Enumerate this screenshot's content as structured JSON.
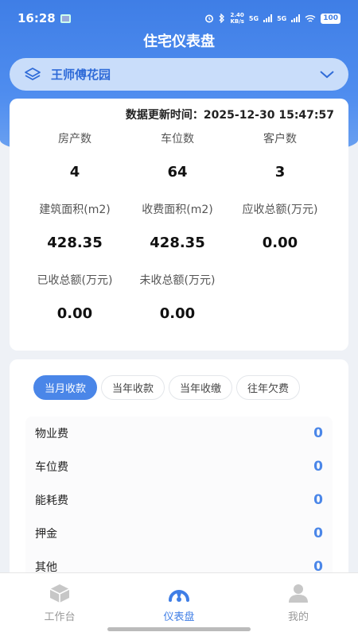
{
  "status": {
    "time": "16:28",
    "speed_top": "2.40",
    "speed_unit": "KB/s",
    "net1": "5G",
    "net2": "5G",
    "battery": "100"
  },
  "header": {
    "title": "住宅仪表盘"
  },
  "selector": {
    "label": "王师傅花园",
    "icon": "stack-layers-icon",
    "chevron": "chevron-down-icon"
  },
  "stats": {
    "update_label": "数据更新时间：",
    "update_time": "2025-12-30 15:47:57",
    "items": [
      {
        "label": "房产数",
        "value": "4"
      },
      {
        "label": "车位数",
        "value": "64"
      },
      {
        "label": "客户数",
        "value": "3"
      },
      {
        "label": "建筑面积(m2)",
        "value": "428.35"
      },
      {
        "label": "收费面积(m2)",
        "value": "428.35"
      },
      {
        "label": "应收总额(万元)",
        "value": "0.00"
      },
      {
        "label": "已收总额(万元)",
        "value": "0.00"
      },
      {
        "label": "未收总额(万元)",
        "value": "0.00"
      }
    ]
  },
  "fees": {
    "tabs": [
      "当月收款",
      "当年收款",
      "当年收缴",
      "往年欠费"
    ],
    "active_tab": 0,
    "rows": [
      {
        "label": "物业费",
        "value": "0"
      },
      {
        "label": "车位费",
        "value": "0"
      },
      {
        "label": "能耗费",
        "value": "0"
      },
      {
        "label": "押金",
        "value": "0"
      },
      {
        "label": "其他",
        "value": "0"
      }
    ]
  },
  "tabbar": {
    "items": [
      {
        "label": "工作台",
        "icon": "box-icon"
      },
      {
        "label": "仪表盘",
        "icon": "gauge-icon"
      },
      {
        "label": "我的",
        "icon": "user-icon"
      }
    ],
    "active": 1
  },
  "colors": {
    "accent": "#4a86e8",
    "header": "#3f7ee6"
  }
}
